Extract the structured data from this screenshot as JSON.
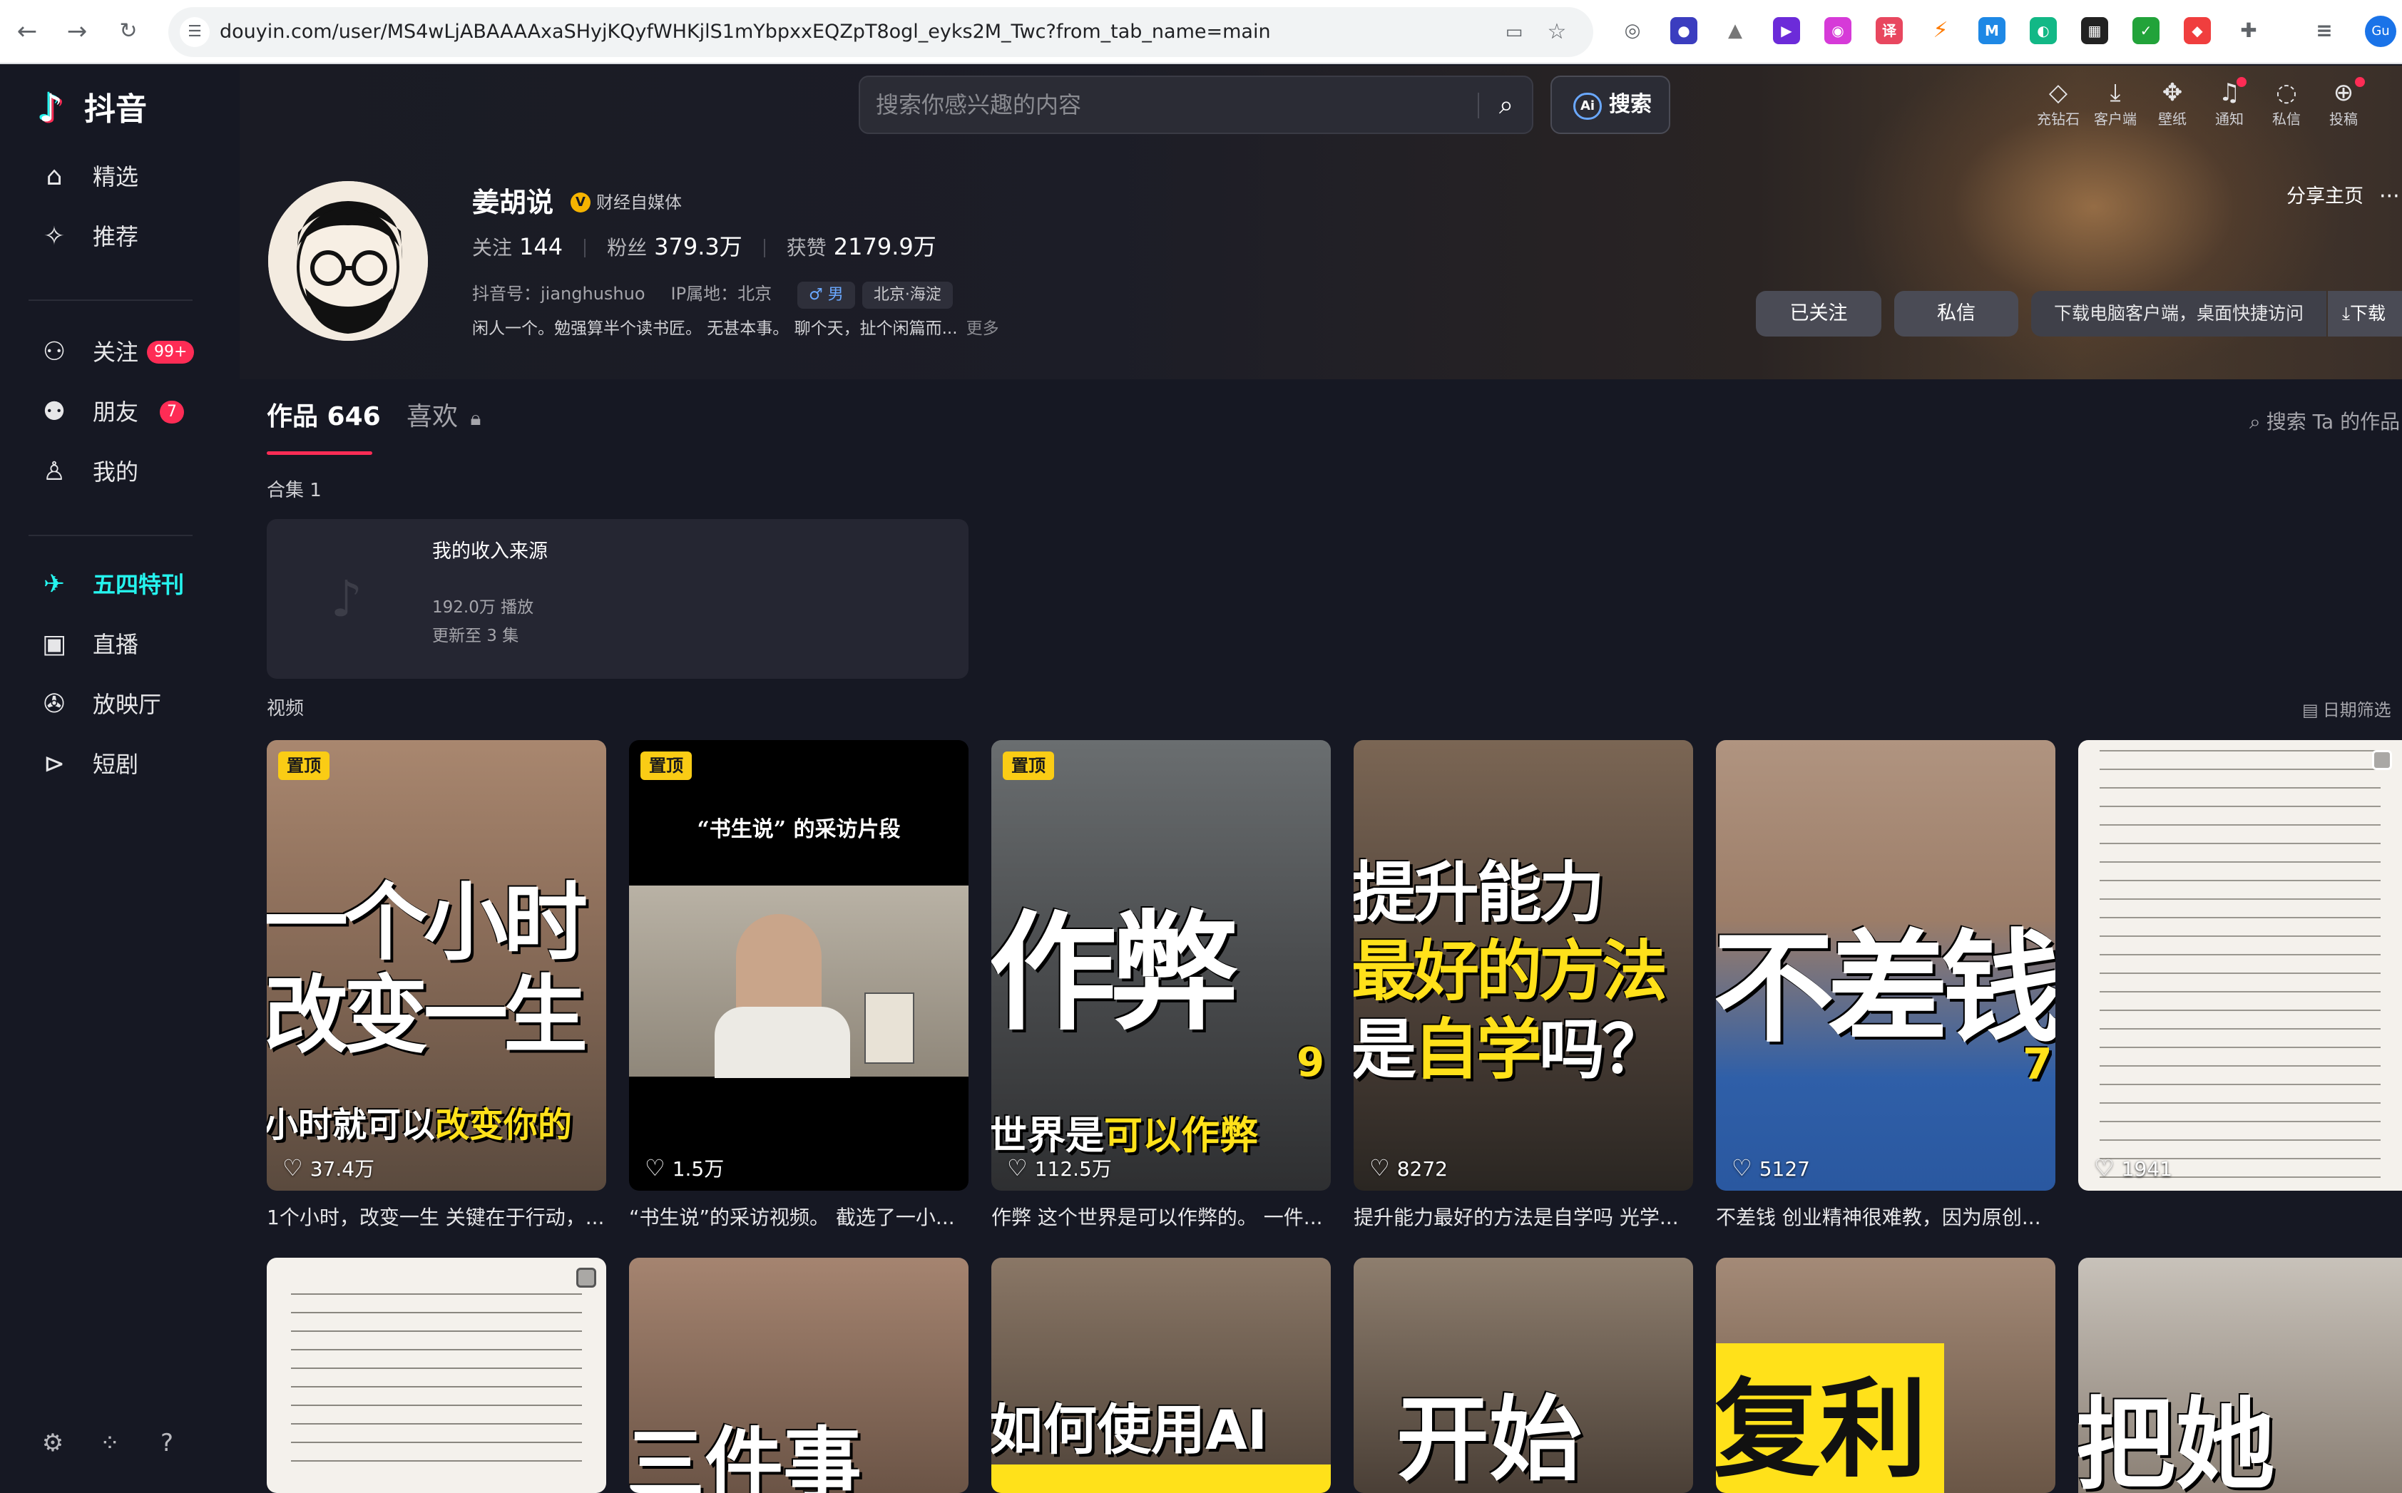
{
  "browser": {
    "url": "douyin.com/user/MS4wLjABAAAAxaSHyjKQyfWHKjlS1mYbpxxEQZpT8ogl_eyks2M_Twc?from_tab_name=main",
    "avatar_initials": "Gu"
  },
  "sidebar": {
    "logo_text": "抖音",
    "items": [
      {
        "label": "精选",
        "icon": "home-icon"
      },
      {
        "label": "推荐",
        "icon": "sparkle-icon"
      },
      {
        "label": "关注",
        "icon": "follow-icon",
        "badge": "99+"
      },
      {
        "label": "朋友",
        "icon": "friends-icon",
        "badge": "7"
      },
      {
        "label": "我的",
        "icon": "user-icon"
      },
      {
        "label": "五四特刊",
        "icon": "paper-plane-icon",
        "active": true
      },
      {
        "label": "直播",
        "icon": "tv-icon"
      },
      {
        "label": "放映厅",
        "icon": "film-reel-icon"
      },
      {
        "label": "短剧",
        "icon": "play-icon"
      }
    ]
  },
  "header": {
    "search_placeholder": "搜索你感兴趣的内容",
    "ai_search_label": "搜索",
    "toolbar": [
      {
        "label": "充钻石",
        "icon": "diamond-icon"
      },
      {
        "label": "客户端",
        "icon": "download-icon"
      },
      {
        "label": "壁纸",
        "icon": "wallpaper-icon"
      },
      {
        "label": "通知",
        "icon": "bell-icon",
        "dot": true
      },
      {
        "label": "私信",
        "icon": "message-icon",
        "dot": true
      },
      {
        "label": "投稿",
        "icon": "upload-icon"
      }
    ]
  },
  "profile": {
    "name": "姜胡说",
    "verify_label": "财经自媒体",
    "stats": [
      {
        "key": "关注",
        "value": "144"
      },
      {
        "key": "粉丝",
        "value": "379.3万"
      },
      {
        "key": "获赞",
        "value": "2179.9万"
      }
    ],
    "douyin_id": "抖音号：jianghushuo",
    "ip": "IP属地：北京",
    "gender_tag": "♂ 男",
    "location_tag": "北京·海淀",
    "bio": "闲人一个。勉强算半个读书匠。 无甚本事。 聊个天，扯个闲篇而...",
    "bio_more": "更多",
    "share_label": "分享主页",
    "more_label": "···",
    "followed_label": "已关注",
    "message_label": "私信",
    "download_tip": "下载电脑客户端，桌面快捷访问",
    "download_label": "⤓下载"
  },
  "tabs": {
    "works_label": "作品 646",
    "likes_label": "喜欢",
    "search_label": "搜索 Ta 的作品"
  },
  "collection": {
    "section_label": "合集 1",
    "title": "我的收入来源",
    "plays": "192.0万 播放",
    "updated": "更新至 3 集"
  },
  "videos": {
    "section_label": "视频",
    "date_filter": "日期筛选",
    "pin_label": "置顶",
    "row1": [
      {
        "likes": "37.4万",
        "caption": "1个小时，改变一生 关键在于行动，...",
        "pinned": true
      },
      {
        "likes": "1.5万",
        "caption": "“书生说”的采访视频。 截选了一小...",
        "pinned": true
      },
      {
        "likes": "112.5万",
        "caption": "作弊 这个世界是可以作弊的。 一件...",
        "pinned": true
      },
      {
        "likes": "8272",
        "caption": "提升能力最好的方法是自学吗 光学...",
        "pinned": false
      },
      {
        "likes": "5127",
        "caption": "不差钱 创业精神很难教，因为原创...",
        "pinned": false
      },
      {
        "likes": "1941",
        "caption": "",
        "pinned": false
      }
    ]
  }
}
